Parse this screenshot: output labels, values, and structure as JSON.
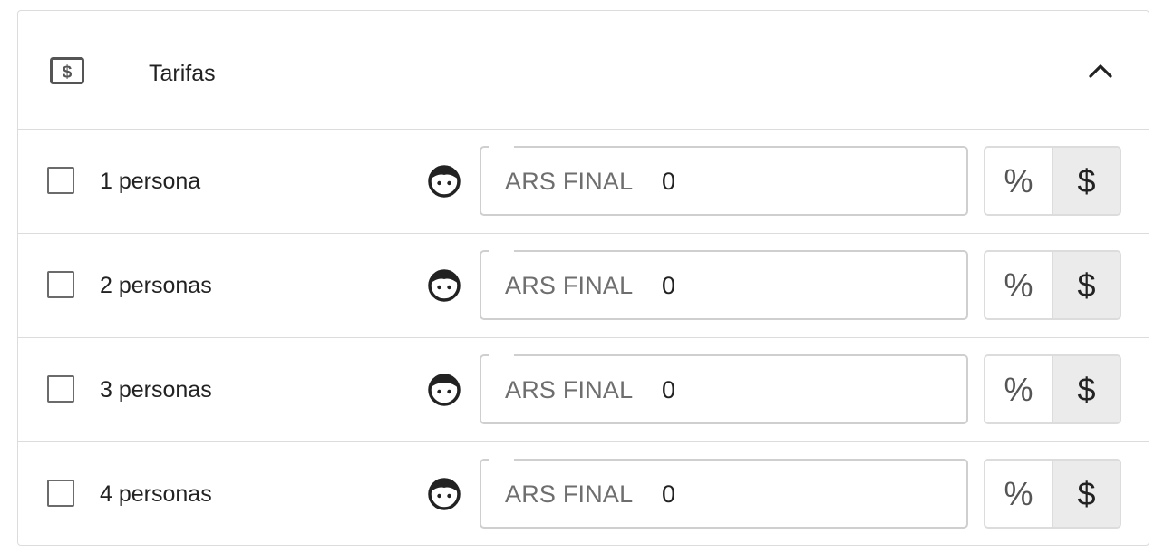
{
  "section": {
    "title": "Tarifas",
    "icon": "money-bill-icon",
    "expanded": true,
    "collapse_icon": "chevron-up-icon"
  },
  "rows": [
    {
      "label": "1 persona",
      "checked": false,
      "currency": "ARS FINAL",
      "value": "0",
      "percent_label": "%",
      "currency_label": "$",
      "selected_mode": "$",
      "guest_icon": "face-icon"
    },
    {
      "label": "2 personas",
      "checked": false,
      "currency": "ARS FINAL",
      "value": "0",
      "percent_label": "%",
      "currency_label": "$",
      "selected_mode": "$",
      "guest_icon": "face-icon"
    },
    {
      "label": "3 personas",
      "checked": false,
      "currency": "ARS FINAL",
      "value": "0",
      "percent_label": "%",
      "currency_label": "$",
      "selected_mode": "$",
      "guest_icon": "face-icon"
    },
    {
      "label": "4 personas",
      "checked": false,
      "currency": "ARS FINAL",
      "value": "0",
      "percent_label": "%",
      "currency_label": "$",
      "selected_mode": "$",
      "guest_icon": "face-icon"
    }
  ],
  "colors": {
    "border": "#dcdcdc",
    "text": "#222222",
    "muted_text": "#6e6e6e",
    "selected_toggle_bg": "#ebebeb"
  }
}
